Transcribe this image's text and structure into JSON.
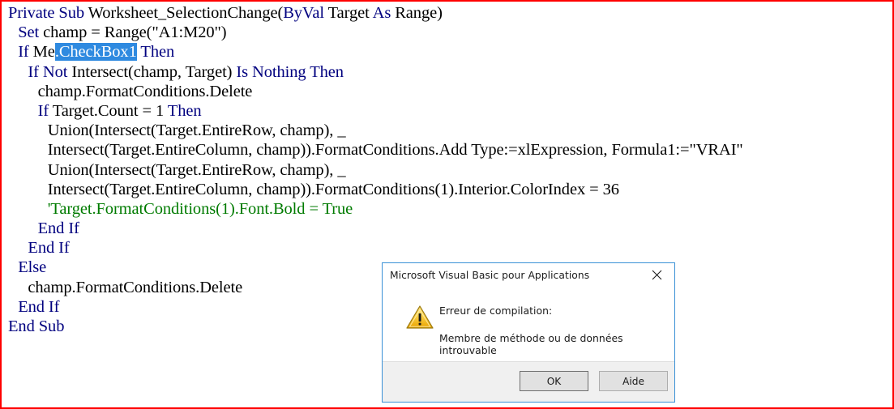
{
  "editor": {
    "language": "vba",
    "selection_text": ".CheckBox1",
    "code_lines": [
      {
        "indent": 0,
        "parts": [
          {
            "t": "Private Sub ",
            "s": "kw"
          },
          {
            "t": "Worksheet_SelectionChange(",
            "s": "pl"
          },
          {
            "t": "ByVal ",
            "s": "kw"
          },
          {
            "t": "Target ",
            "s": "pl"
          },
          {
            "t": "As ",
            "s": "kw"
          },
          {
            "t": "Range)",
            "s": "pl"
          }
        ]
      },
      {
        "indent": 1,
        "parts": [
          {
            "t": "Set ",
            "s": "kw"
          },
          {
            "t": "champ = Range(\"A1:M20\")",
            "s": "pl"
          }
        ]
      },
      {
        "indent": 1,
        "parts": [
          {
            "t": "If ",
            "s": "kw"
          },
          {
            "t": "Me",
            "s": "pl"
          },
          {
            "t": ".CheckBox1",
            "s": "sel"
          },
          {
            "t": " ",
            "s": "pl"
          },
          {
            "t": "Then",
            "s": "kw"
          }
        ]
      },
      {
        "indent": 2,
        "parts": [
          {
            "t": "If Not ",
            "s": "kw"
          },
          {
            "t": "Intersect(champ, Target) ",
            "s": "pl"
          },
          {
            "t": "Is Nothing Then",
            "s": "kw"
          }
        ]
      },
      {
        "indent": 3,
        "parts": [
          {
            "t": "champ.FormatConditions.Delete",
            "s": "pl"
          }
        ]
      },
      {
        "indent": 3,
        "parts": [
          {
            "t": "If ",
            "s": "kw"
          },
          {
            "t": "Target.Count = 1 ",
            "s": "pl"
          },
          {
            "t": "Then",
            "s": "kw"
          }
        ]
      },
      {
        "indent": 4,
        "parts": [
          {
            "t": "Union(Intersect(Target.EntireRow, champ), _",
            "s": "pl"
          }
        ]
      },
      {
        "indent": 4,
        "parts": [
          {
            "t": "Intersect(Target.EntireColumn, champ)).FormatConditions.Add Type:=xlExpression, Formula1:=\"VRAI\"",
            "s": "pl"
          }
        ]
      },
      {
        "indent": 4,
        "parts": [
          {
            "t": "Union(Intersect(Target.EntireRow, champ), _",
            "s": "pl"
          }
        ]
      },
      {
        "indent": 4,
        "parts": [
          {
            "t": "Intersect(Target.EntireColumn, champ)).FormatConditions(1).Interior.ColorIndex = 36",
            "s": "pl"
          }
        ]
      },
      {
        "indent": 4,
        "parts": [
          {
            "t": "'Target.FormatConditions(1).Font.Bold = True",
            "s": "cm"
          }
        ]
      },
      {
        "indent": 3,
        "parts": [
          {
            "t": "End If",
            "s": "kw"
          }
        ]
      },
      {
        "indent": 2,
        "parts": [
          {
            "t": "End If",
            "s": "kw"
          }
        ]
      },
      {
        "indent": 1,
        "parts": [
          {
            "t": "Else",
            "s": "kw"
          }
        ]
      },
      {
        "indent": 2,
        "parts": [
          {
            "t": "champ.FormatConditions.Delete",
            "s": "pl"
          }
        ]
      },
      {
        "indent": 1,
        "parts": [
          {
            "t": "End If",
            "s": "kw"
          }
        ]
      },
      {
        "indent": 0,
        "parts": [
          {
            "t": "End Sub",
            "s": "kw"
          }
        ]
      }
    ]
  },
  "dialog": {
    "title": "Microsoft Visual Basic pour Applications",
    "close_icon": "close-icon",
    "icon": "warning-icon",
    "message_line1": "Erreur de compilation:",
    "message_line2": "Membre de méthode ou de données introuvable",
    "buttons": {
      "ok": "OK",
      "help": "Aide"
    }
  },
  "colors": {
    "keyword": "#00007f",
    "comment": "#007b00",
    "plain": "#000000",
    "selection_bg": "#2f8ae0",
    "selection_fg": "#ffffff",
    "dialog_border": "#3a91d6",
    "outer_border": "#ff0000",
    "warning_yellow": "#ffcc33"
  }
}
